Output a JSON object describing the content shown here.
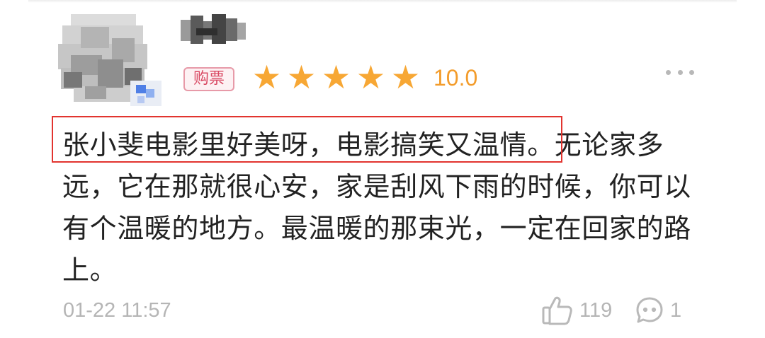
{
  "comment": {
    "ticket_badge": "购票",
    "rating_stars": 5,
    "rating_max": 5,
    "score": "10.0",
    "review_text": "张小斐电影里好美呀，电影搞笑又温情。无论家多远，它在那就很心安，家是刮风下雨的时候，你可以有个温暖的地方。最温暖的那束光，一定在回家的路上。",
    "highlighted_text": "张小斐电影里好美呀，电影搞笑又温情。",
    "timestamp": "01-22 11:57",
    "like_count": "119",
    "comment_count": "1"
  },
  "icons": {
    "star": "star-icon",
    "more": "more-icon",
    "like": "thumbs-up-icon",
    "comment": "comment-bubble-icon"
  },
  "colors": {
    "star": "#f7a734",
    "score": "#f39c2b",
    "badge_text": "#d94a64",
    "badge_border": "#e79aa8",
    "highlight_box": "#e2342f",
    "muted_text": "#b5b5b5",
    "body_text": "#222222"
  }
}
